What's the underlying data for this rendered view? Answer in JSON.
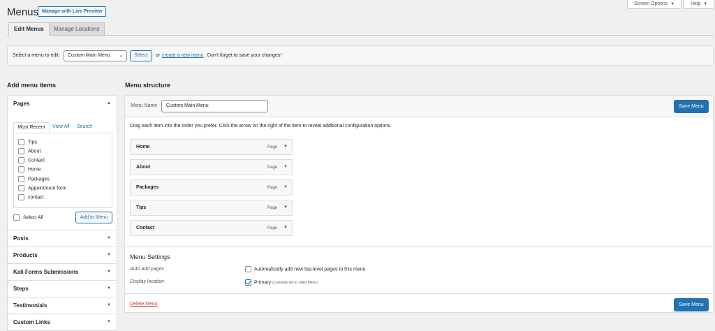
{
  "header": {
    "title": "Menus",
    "live_preview": "Manage with Live Preview",
    "screen_options": "Screen Options",
    "help": "Help"
  },
  "tabs": [
    "Edit Menus",
    "Manage Locations"
  ],
  "select_bar": {
    "label": "Select a menu to edit:",
    "selected_menu": "Custom Main Menu",
    "select_button": "Select",
    "or_text": "or",
    "create_link": "create a new menu",
    "after_text": ". Don't forget to save your changes!"
  },
  "left": {
    "heading": "Add menu items",
    "pages_panel": {
      "title": "Pages",
      "tabs": [
        "Most Recent",
        "View All",
        "Search"
      ],
      "items": [
        "Tips",
        "About",
        "Contact",
        "Home",
        "Packages",
        "Appointment form",
        "contact"
      ],
      "select_all": "Select All",
      "add_button": "Add to Menu"
    },
    "collapsed_panels": [
      "Posts",
      "Products",
      "Kali Forms Submissions",
      "Steps",
      "Testimonials",
      "Custom Links"
    ]
  },
  "right": {
    "heading": "Menu structure",
    "menu_name_label": "Menu Name",
    "menu_name_value": "Custom Main Menu",
    "save_button": "Save Menu",
    "instructions": "Drag each item into the order you prefer. Click the arrow on the right of the item to reveal additional configuration options.",
    "items": [
      {
        "title": "Home",
        "type": "Page"
      },
      {
        "title": "About",
        "type": "Page"
      },
      {
        "title": "Packages",
        "type": "Page"
      },
      {
        "title": "Tips",
        "type": "Page"
      },
      {
        "title": "Contact",
        "type": "Page"
      }
    ],
    "settings": {
      "title": "Menu Settings",
      "auto_add_label": "Auto add pages",
      "auto_add_text": "Automatically add new top-level pages to this menu",
      "display_label": "Display location",
      "primary_text": "Primary",
      "primary_note": "(Currently set to: Main Menu)"
    },
    "delete_link": "Delete Menu"
  },
  "colors": {
    "accent": "#2271b1",
    "delete": "#d63638",
    "background": "#f0f0f1"
  }
}
